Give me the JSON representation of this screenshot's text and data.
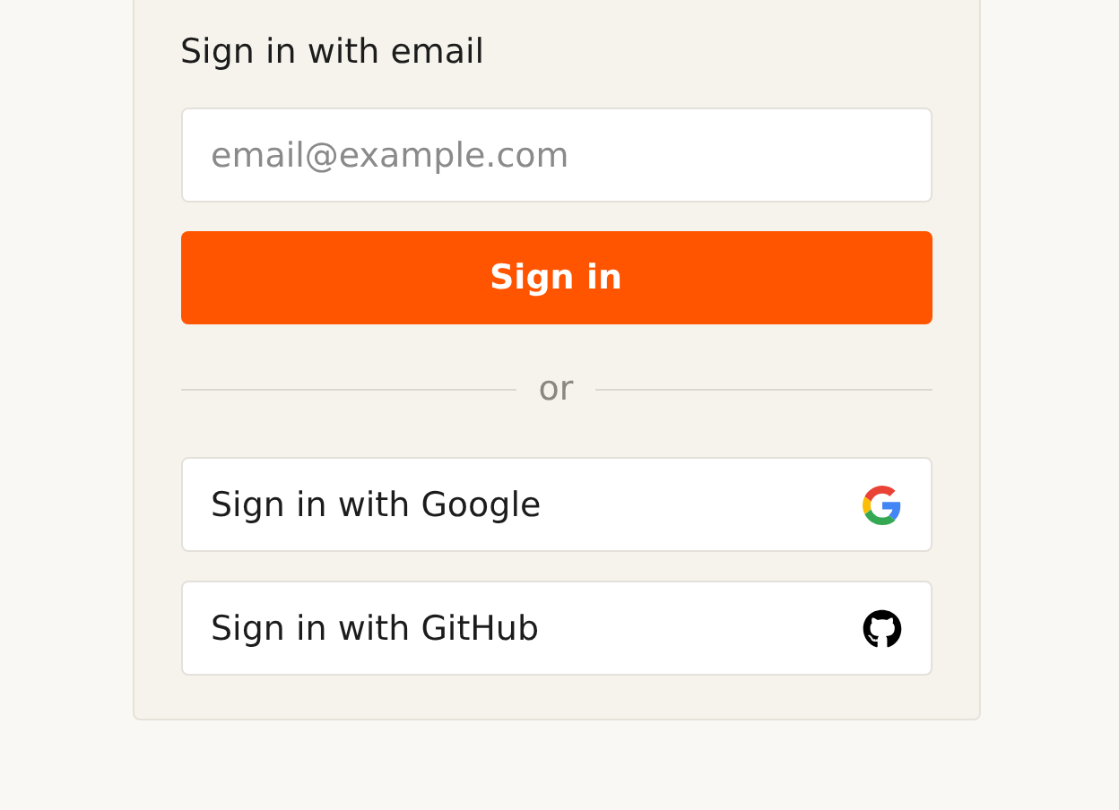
{
  "form": {
    "title": "Sign in with email",
    "email": {
      "placeholder": "email@example.com"
    },
    "submit": "Sign in",
    "divider": "or",
    "providers": [
      {
        "kind": "google",
        "label": "Sign in with Google"
      },
      {
        "kind": "github",
        "label": "Sign in with GitHub"
      }
    ]
  }
}
